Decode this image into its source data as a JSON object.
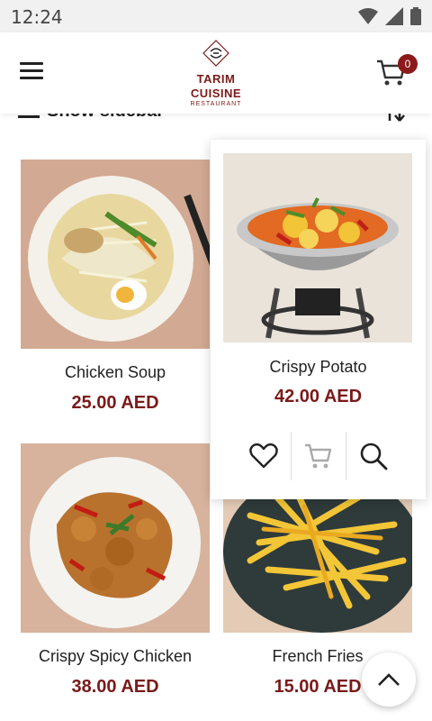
{
  "status": {
    "time": "12:24"
  },
  "header": {
    "logo_line1": "TARIM",
    "logo_line2": "CUISINE",
    "logo_line3": "RESTAURANT",
    "cart_count": "0"
  },
  "toolbar": {
    "sidebar_label": "Show sidebar"
  },
  "products": [
    {
      "name": "Chicken Soup",
      "price": "25.00 AED"
    },
    {
      "name": "Crispy Potato",
      "price": "42.00 AED"
    },
    {
      "name": "Crispy Spicy Chicken",
      "price": "38.00 AED"
    },
    {
      "name": "French Fries",
      "price": "15.00 AED"
    }
  ],
  "colors": {
    "accent": "#7a1a1a",
    "badge": "#8b1a1a"
  }
}
